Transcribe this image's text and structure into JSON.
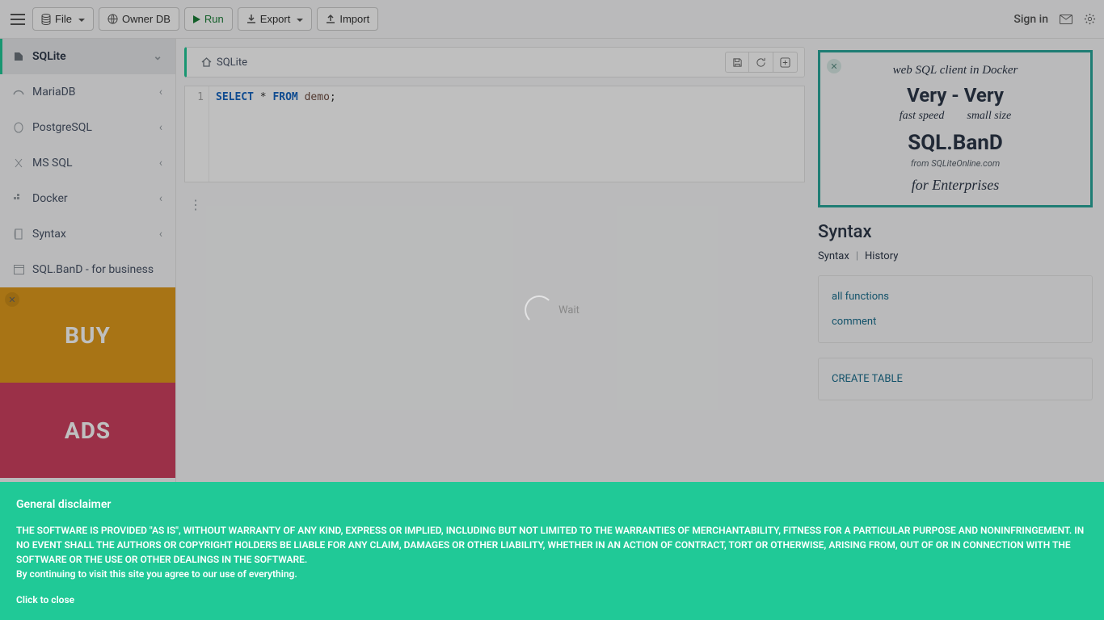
{
  "toolbar": {
    "file": "File",
    "owner_db": "Owner DB",
    "run": "Run",
    "export": "Export",
    "import": "Import",
    "signin": "Sign in"
  },
  "sidebar": {
    "items": [
      {
        "label": "SQLite"
      },
      {
        "label": "MariaDB"
      },
      {
        "label": "PostgreSQL"
      },
      {
        "label": "MS SQL"
      },
      {
        "label": "Docker"
      },
      {
        "label": "Syntax"
      },
      {
        "label": "SQL.BanD - for business"
      }
    ],
    "ad_buy": "BUY",
    "ad_ads": "ADS"
  },
  "editor": {
    "tab_label": "SQLite",
    "line_number": "1",
    "kw_select": "SELECT",
    "star": "*",
    "kw_from": "FROM",
    "table": "demo",
    "semicolon": ";"
  },
  "loader_text": "Wait",
  "promo": {
    "t1": "web SQL client in Docker",
    "t2": "Very - Very",
    "t3a": "fast speed",
    "t3b": "small size",
    "t4": "SQL.BanD",
    "t5": "from SQLiteOnline.com",
    "t6": "for Enterprises"
  },
  "right_panel": {
    "title": "Syntax",
    "tab_syntax": "Syntax",
    "tab_history": "History",
    "links": [
      {
        "label": "all functions"
      },
      {
        "label": "comment"
      }
    ],
    "expand": "CREATE TABLE"
  },
  "disclaimer": {
    "title": "General disclaimer",
    "body": "THE SOFTWARE IS PROVIDED \"AS IS\", WITHOUT WARRANTY OF ANY KIND, EXPRESS OR IMPLIED, INCLUDING BUT NOT LIMITED TO THE WARRANTIES OF MERCHANTABILITY, FITNESS FOR A PARTICULAR PURPOSE AND NONINFRINGEMENT. IN NO EVENT SHALL THE AUTHORS OR COPYRIGHT HOLDERS BE LIABLE FOR ANY CLAIM, DAMAGES OR OTHER LIABILITY, WHETHER IN AN ACTION OF CONTRACT, TORT OR OTHERWISE, ARISING FROM, OUT OF OR IN CONNECTION WITH THE SOFTWARE OR THE USE OR OTHER DEALINGS IN THE SOFTWARE.",
    "agree": "By continuing to visit this site you agree to our use of everything.",
    "close": "Click to close"
  }
}
